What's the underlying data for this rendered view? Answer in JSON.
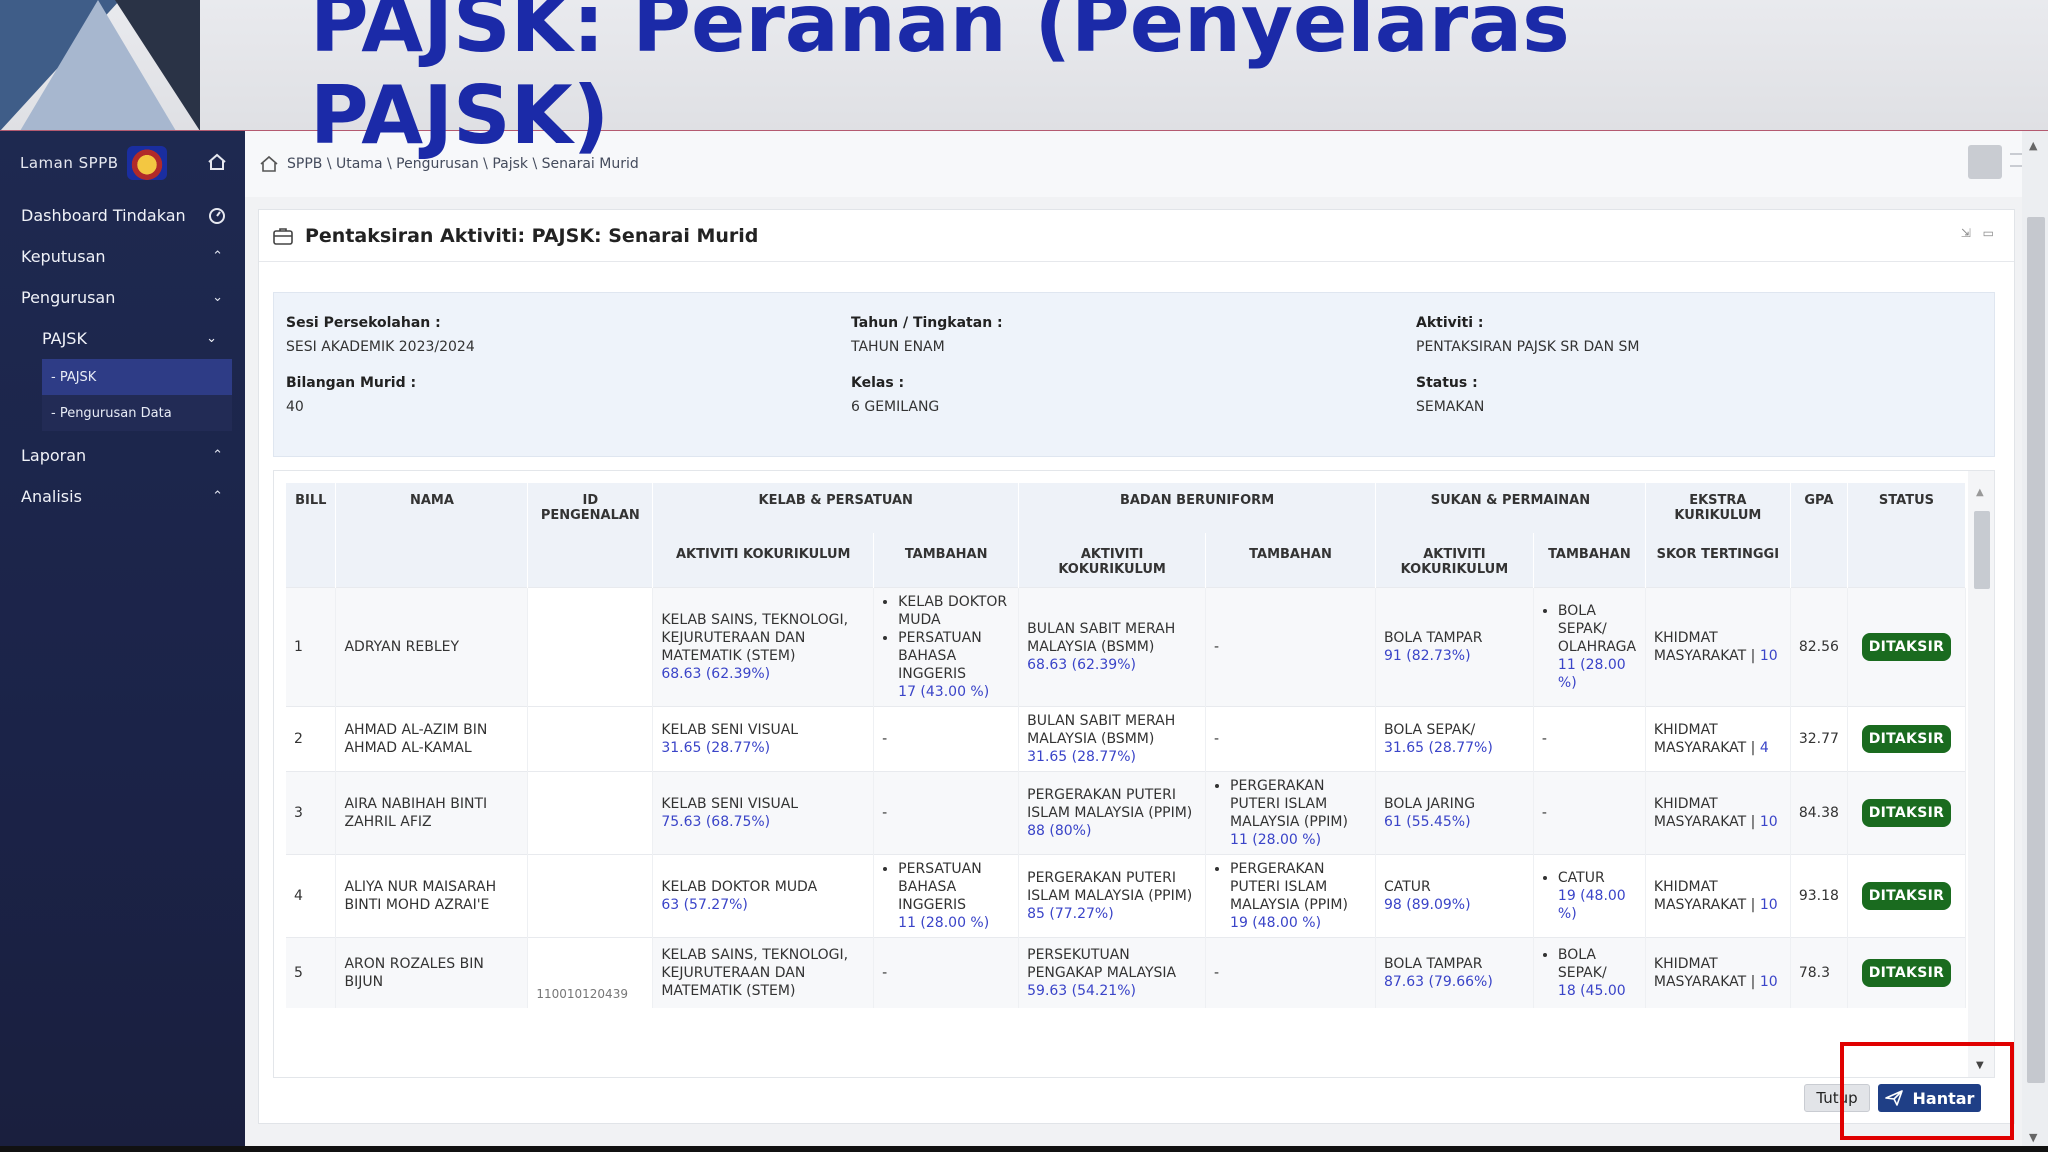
{
  "banner": {
    "title": "PAJSK: Peranan (Penyelaras PAJSK)"
  },
  "sidebar": {
    "brand": "Laman SPPB",
    "items": [
      {
        "label": "Dashboard Tindakan",
        "chevron": ""
      },
      {
        "label": "Keputusan",
        "chevron": "⌃"
      },
      {
        "label": "Pengurusan",
        "chevron": "⌄"
      }
    ],
    "sub": {
      "label": "PAJSK",
      "chevron": "⌄"
    },
    "subsub": [
      {
        "label": "- PAJSK"
      },
      {
        "label": "- Pengurusan Data"
      }
    ],
    "bottom_items": [
      {
        "label": "Laporan",
        "chevron": "⌃"
      },
      {
        "label": "Analisis",
        "chevron": "⌃"
      }
    ]
  },
  "breadcrumb": "SPPB \\ Utama \\ Pengurusan \\ Pajsk \\ Senarai Murid",
  "card": {
    "title": "Pentaksiran Aktiviti: PAJSK: Senarai Murid",
    "info": {
      "sesi_label": "Sesi Persekolahan :",
      "sesi_value": "SESI AKADEMIK 2023/2024",
      "tahun_label": "Tahun / Tingkatan :",
      "tahun_value": "TAHUN ENAM",
      "aktiviti_label": "Aktiviti :",
      "aktiviti_value": "PENTAKSIRAN PAJSK SR DAN SM",
      "bilangan_label": "Bilangan Murid :",
      "bilangan_value": "40",
      "kelas_label": "Kelas :",
      "kelas_value": "6 GEMILANG",
      "status_label": "Status :",
      "status_value": "SEMAKAN"
    }
  },
  "table": {
    "headers": {
      "bill": "BILL",
      "nama": "NAMA",
      "id": "ID PENGENALAN",
      "kelab": "KELAB & PERSATUAN",
      "badan": "BADAN BERUNIFORM",
      "sukan": "SUKAN & PERMAINAN",
      "ekstra": "EKSTRA KURIKULUM",
      "gpa": "GPA",
      "status": "STATUS",
      "aktiviti": "AKTIVITI KOKURIKULUM",
      "tambahan": "TAMBAHAN",
      "skor": "SKOR TERTINGGI"
    },
    "rows": [
      {
        "bill": "1",
        "nama": "ADRYAN REBLEY",
        "id": "",
        "kelab": "KELAB SAINS, TEKNOLOGI, KEJURUTERAAN DAN MATEMATIK (STEM)",
        "kelab_score": "68.63 (62.39%)",
        "kelab_tambahan": [
          "KELAB DOKTOR MUDA",
          "PERSATUAN BAHASA INGGERIS"
        ],
        "kelab_tambahan_score": "17 (43.00 %)",
        "badan": "BULAN SABIT MERAH MALAYSIA (BSMM)",
        "badan_score": "68.63 (62.39%)",
        "badan_tambahan": [],
        "badan_tambahan_text": "-",
        "badan_tambahan_score": "",
        "sukan": "BOLA TAMPAR",
        "sukan_score": "91 (82.73%)",
        "sukan_tambahan": [
          "BOLA SEPAK/ OLAHRAGA"
        ],
        "sukan_tambahan_text": "",
        "sukan_tambahan_score": "11 (28.00 %)",
        "ekstra": "KHIDMAT MASYARAKAT |",
        "ekstra_score": "10",
        "gpa": "82.56",
        "status": "DITAKSIR"
      },
      {
        "bill": "2",
        "nama": "AHMAD AL-AZIM BIN AHMAD AL-KAMAL",
        "id": "",
        "kelab": "KELAB SENI VISUAL",
        "kelab_score": "31.65 (28.77%)",
        "kelab_tambahan": [],
        "kelab_tambahan_text": "-",
        "kelab_tambahan_score": "",
        "badan": "BULAN SABIT MERAH MALAYSIA (BSMM)",
        "badan_score": "31.65 (28.77%)",
        "badan_tambahan": [],
        "badan_tambahan_text": "-",
        "badan_tambahan_score": "",
        "sukan": "BOLA SEPAK/",
        "sukan_score": "31.65 (28.77%)",
        "sukan_tambahan": [],
        "sukan_tambahan_text": "-",
        "sukan_tambahan_score": "",
        "ekstra": "KHIDMAT MASYARAKAT |",
        "ekstra_score": "4",
        "gpa": "32.77",
        "status": "DITAKSIR"
      },
      {
        "bill": "3",
        "nama": "AIRA NABIHAH BINTI ZAHRIL AFIZ",
        "id": "",
        "kelab": "KELAB SENI VISUAL",
        "kelab_score": "75.63 (68.75%)",
        "kelab_tambahan": [],
        "kelab_tambahan_text": "-",
        "kelab_tambahan_score": "",
        "badan": "PERGERAKAN PUTERI ISLAM MALAYSIA (PPIM)",
        "badan_score": "88 (80%)",
        "badan_tambahan": [
          "PERGERAKAN PUTERI ISLAM MALAYSIA (PPIM)"
        ],
        "badan_tambahan_text": "",
        "badan_tambahan_score": "11 (28.00 %)",
        "sukan": "BOLA JARING",
        "sukan_score": "61 (55.45%)",
        "sukan_tambahan": [],
        "sukan_tambahan_text": "-",
        "sukan_tambahan_score": "",
        "ekstra": "KHIDMAT MASYARAKAT |",
        "ekstra_score": "10",
        "gpa": "84.38",
        "status": "DITAKSIR"
      },
      {
        "bill": "4",
        "nama": "ALIYA NUR MAISARAH BINTI MOHD AZRAI'E",
        "id": "",
        "kelab": "KELAB DOKTOR MUDA",
        "kelab_score": "63 (57.27%)",
        "kelab_tambahan": [
          "PERSATUAN BAHASA INGGERIS"
        ],
        "kelab_tambahan_score": "11 (28.00 %)",
        "badan": "PERGERAKAN PUTERI ISLAM MALAYSIA (PPIM)",
        "badan_score": "85 (77.27%)",
        "badan_tambahan": [
          "PERGERAKAN PUTERI ISLAM MALAYSIA (PPIM)"
        ],
        "badan_tambahan_text": "",
        "badan_tambahan_score": "19 (48.00 %)",
        "sukan": "CATUR",
        "sukan_score": "98 (89.09%)",
        "sukan_tambahan": [
          "CATUR"
        ],
        "sukan_tambahan_text": "",
        "sukan_tambahan_score": "19 (48.00 %)",
        "ekstra": "KHIDMAT MASYARAKAT |",
        "ekstra_score": "10",
        "gpa": "93.18",
        "status": "DITAKSIR"
      },
      {
        "bill": "5",
        "nama": "ARON ROZALES BIN BIJUN",
        "id": "110010120439",
        "kelab": "KELAB SAINS, TEKNOLOGI, KEJURUTERAAN DAN MATEMATIK (STEM)",
        "kelab_score": "",
        "kelab_tambahan": [],
        "kelab_tambahan_text": "-",
        "kelab_tambahan_score": "",
        "badan": "PERSEKUTUAN PENGAKAP MALAYSIA",
        "badan_score": "59.63 (54.21%)",
        "badan_tambahan": [],
        "badan_tambahan_text": "-",
        "badan_tambahan_score": "",
        "sukan": "BOLA TAMPAR",
        "sukan_score": "87.63 (79.66%)",
        "sukan_tambahan": [
          "BOLA SEPAK/"
        ],
        "sukan_tambahan_text": "",
        "sukan_tambahan_score": "18 (45.00",
        "ekstra": "KHIDMAT MASYARAKAT |",
        "ekstra_score": "10",
        "gpa": "78.3",
        "status": "DITAKSIR"
      }
    ]
  },
  "buttons": {
    "tutup": "Tutup",
    "hantar": "Hantar"
  },
  "colors": {
    "accent": "#1f3f86",
    "badge": "#1a6b1f",
    "score": "#3a44c8",
    "title": "#1b2aa8",
    "highlight": "#e00000"
  }
}
